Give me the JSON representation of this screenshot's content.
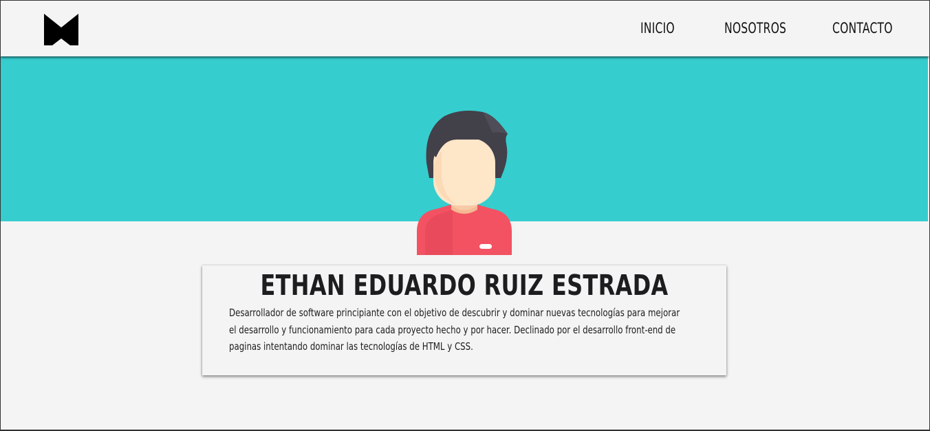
{
  "header": {
    "logo": {
      "icon": "m-logo-icon",
      "color": "#000000"
    },
    "nav": [
      {
        "label": "INICIO"
      },
      {
        "label": "NOSOTROS"
      },
      {
        "label": "CONTACTO"
      }
    ]
  },
  "hero": {
    "background_color": "#36cdcf",
    "avatar": {
      "icon": "user-avatar-icon"
    }
  },
  "profile": {
    "name": "ETHAN EDUARDO RUIZ ESTRADA",
    "description": "Desarrollador de software principiante con el objetivo de descubrir y dominar nuevas tecnologías para mejorar el desarrollo y funcionamiento para cada proyecto hecho y por hacer. Declinado por el desarrollo front-end de paginas intentando dominar las tecnologías de HTML y CSS."
  }
}
